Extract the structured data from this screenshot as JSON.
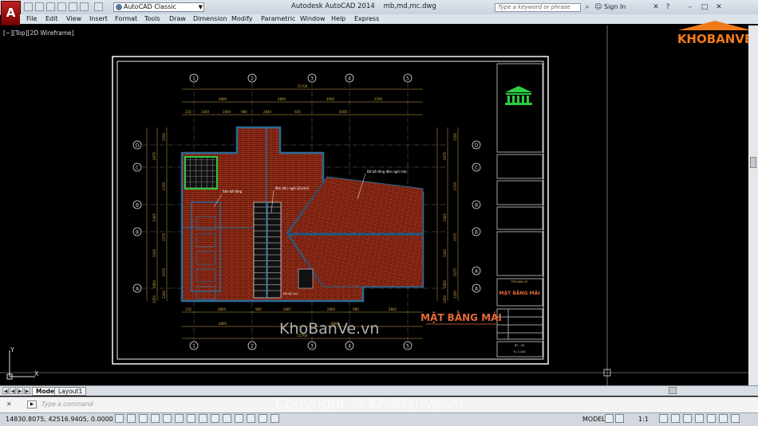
{
  "window": {
    "title": "Autodesk AutoCAD 2014",
    "filename": "mb,md,mc.dwg",
    "workspace": "AutoCAD Classic",
    "search_placeholder": "Type a keyword or phrase",
    "signin": "Sign In"
  },
  "menu": [
    "File",
    "Edit",
    "View",
    "Insert",
    "Format",
    "Tools",
    "Draw",
    "Dimension",
    "Modify",
    "Parametric",
    "Window",
    "Help",
    "Express"
  ],
  "viewport_label": "[−][Top][2D Wireframe]",
  "drawing": {
    "plan_title": "MẶT BẰNG MÁI",
    "total_width_label": "15700",
    "top_dims_row1": [
      "4800",
      "4800",
      "3600",
      "2500"
    ],
    "top_dims_row2": [
      "210",
      "1040",
      "1000",
      "980",
      "2840",
      "920",
      "4500"
    ],
    "bottom_dims_row1": [
      "210",
      "4800",
      "980",
      "2887",
      "2800",
      "980",
      "2842"
    ],
    "bottom_dims_row2": [
      "4800",
      "6800"
    ],
    "bottom_total": "15700",
    "grid_cols": [
      "1",
      "2",
      "3",
      "4",
      "5"
    ],
    "grid_rows_left": [
      "D",
      "C",
      "B",
      "B",
      "A"
    ],
    "grid_rows_right": [
      "D",
      "C",
      "B",
      "B",
      "A",
      "A"
    ],
    "left_dims": [
      "1250",
      "2975",
      "3705",
      "2405",
      "1575",
      "1200",
      "2575",
      "1850",
      "1200",
      "1050"
    ],
    "right_dims": [
      "1250",
      "2975",
      "3705",
      "2405",
      "1575",
      "1200",
      "2575",
      "1850",
      "1200",
      "1050"
    ],
    "annotations": [
      "Đổ bê tông đán ngói mái",
      "Mái đán ngói 22v/m2",
      "Sàn bê tông",
      "ĐÁ XẸ 1x2"
    ],
    "title_block_title": "MẶT BẰNG MÁI",
    "title_block_sub": "TÊN BẢN VẼ",
    "title_block_scale": "TL 1:100",
    "title_block_sheet": "KT - 03"
  },
  "watermark_site": "KhoBanVe.vn",
  "watermark_copyright": "Copyright © KhoBanVe.vn",
  "logo_text": "KHOBANVE",
  "tabs": [
    "Model",
    "Layout1"
  ],
  "cmd_placeholder": "Type a command",
  "status": {
    "coords": "14830.8075, 42516.9405, 0.0000",
    "model": "MODEL",
    "scale": "1:1"
  },
  "colors": {
    "brick": "#7a1f0e",
    "brick_line": "#c94a30",
    "wall": "#1f5f8a",
    "dim": "#d4a64a",
    "grid_bubble": "#dddddd",
    "stair": "#ffffff",
    "logo_orange": "#f07a1a"
  }
}
